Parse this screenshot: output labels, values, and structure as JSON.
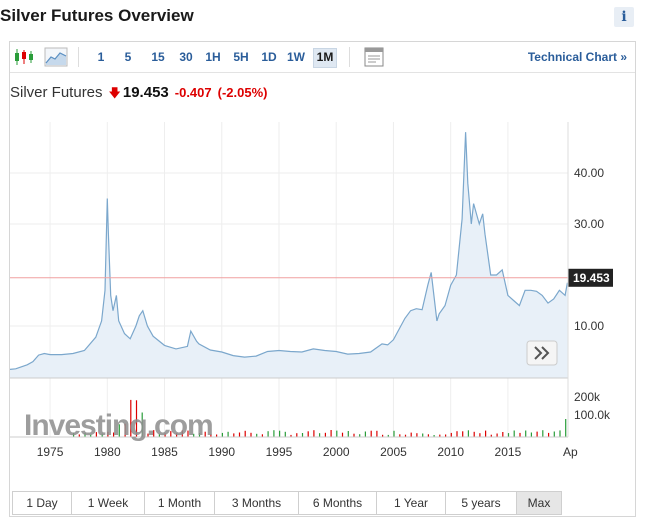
{
  "page": {
    "title": "Silver Futures Overview"
  },
  "toolbar": {
    "intervals": [
      {
        "label": "1",
        "active": false
      },
      {
        "label": "5",
        "active": false
      },
      {
        "label": "15",
        "active": false
      },
      {
        "label": "30",
        "active": false
      },
      {
        "label": "1H",
        "active": false
      },
      {
        "label": "5H",
        "active": false
      },
      {
        "label": "1D",
        "active": false
      },
      {
        "label": "1W",
        "active": false
      },
      {
        "label": "1M",
        "active": true
      }
    ],
    "technical_link": "Technical Chart »",
    "icons": [
      "candlestick-chart-icon",
      "area-chart-icon",
      "settings-panel-icon"
    ]
  },
  "quote": {
    "name": "Silver Futures",
    "direction": "down",
    "price": "19.453",
    "change": "-0.407",
    "change_pct": "(-2.05%)"
  },
  "colors": {
    "line": "#7ba7cc",
    "area": "#e8f0f8",
    "down": "#dd0000",
    "up": "#2a9d3a",
    "link": "#2a5d9a",
    "price_tag_bg": "#222222",
    "current_line": "#f0a0a0"
  },
  "watermark": "Investing.com",
  "chart_data": {
    "type": "area",
    "price_axis": {
      "ticks": [
        "10.00",
        "30.00",
        "40.00"
      ],
      "current": "19.453"
    },
    "volume_axis": {
      "ticks": [
        "100.0k",
        "200k"
      ]
    },
    "x_axis": {
      "ticks": [
        "1975",
        "1980",
        "1985",
        "1990",
        "1995",
        "2000",
        "2005",
        "2010",
        "2015",
        "Ap"
      ]
    },
    "series": [
      {
        "x": [
          1971.5,
          1972,
          1973,
          1973.5,
          1974,
          1974.5,
          1975,
          1976,
          1977,
          1978,
          1979,
          1979.5,
          1979.8,
          1980.0,
          1980.1,
          1980.3,
          1980.5,
          1980.8,
          1981,
          1981.5,
          1982,
          1982.5,
          1982.8,
          1983.1,
          1983.5,
          1984,
          1985,
          1986,
          1987,
          1987.3,
          1987.8,
          1988,
          1989,
          1990,
          1991,
          1992,
          1993,
          1994,
          1995,
          1996,
          1997,
          1998,
          1999,
          2000,
          2001,
          2002,
          2003,
          2004,
          2004.5,
          2005,
          2006,
          2006.5,
          2007,
          2007.5,
          2008,
          2008.3,
          2008.8,
          2009,
          2009.5,
          2010,
          2010.5,
          2011,
          2011.3,
          2011.5,
          2011.8,
          2012,
          2012.5,
          2012.8,
          2013,
          2013.5,
          2014,
          2014.5,
          2015,
          2015.5,
          2016,
          2016.5,
          2017,
          2017.5,
          2018,
          2018.5,
          2019,
          2019.5,
          2020,
          2020.2
        ],
        "y": [
          1.5,
          1.6,
          2.4,
          3.0,
          4.3,
          4.6,
          4.4,
          4.4,
          4.6,
          5.2,
          7.8,
          11,
          17,
          35,
          28,
          16,
          13,
          16,
          11,
          8.5,
          7.5,
          10,
          12,
          13,
          10,
          8,
          6.2,
          5.5,
          6.0,
          9,
          7,
          6.5,
          5.3,
          4.9,
          4.2,
          3.9,
          4.1,
          5.0,
          5.2,
          5.0,
          4.9,
          5.5,
          5.2,
          5.0,
          4.5,
          4.6,
          4.9,
          6.5,
          6.3,
          7.3,
          11.5,
          13,
          13.4,
          13.2,
          18,
          20.5,
          11,
          12.4,
          14,
          18,
          20,
          31,
          48,
          38,
          30,
          34,
          30,
          32,
          28,
          20,
          20,
          21,
          16,
          15,
          14,
          17,
          17,
          16.8,
          16,
          14.5,
          15.3,
          17,
          16,
          18.5
        ]
      }
    ]
  },
  "range_buttons": [
    {
      "label": "1 Day",
      "selected": false
    },
    {
      "label": "1 Week",
      "selected": false
    },
    {
      "label": "1 Month",
      "selected": false
    },
    {
      "label": "3 Months",
      "selected": false
    },
    {
      "label": "6 Months",
      "selected": false
    },
    {
      "label": "1 Year",
      "selected": false
    },
    {
      "label": "5 years",
      "selected": false
    },
    {
      "label": "Max",
      "selected": true
    }
  ]
}
